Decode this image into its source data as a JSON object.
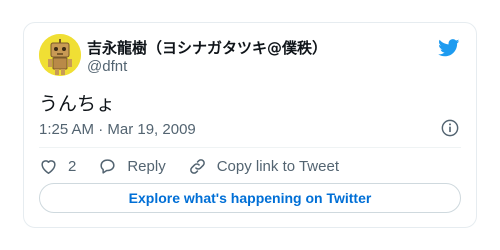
{
  "tweet": {
    "author": {
      "display_name": "吉永龍樹（ヨシナガタツキ@僕秩）",
      "handle": "@dfnt",
      "avatar_icon": "robot-avatar-icon"
    },
    "text": "うんちょ",
    "timestamp": "1:25 AM · Mar 19, 2009",
    "actions": {
      "like_count": "2",
      "reply_label": "Reply",
      "copy_link_label": "Copy link to Tweet"
    },
    "explore_label": "Explore what's happening on Twitter"
  },
  "colors": {
    "brand": "#1d9bf0",
    "secondary_text": "#536471",
    "link": "#006fd6"
  }
}
